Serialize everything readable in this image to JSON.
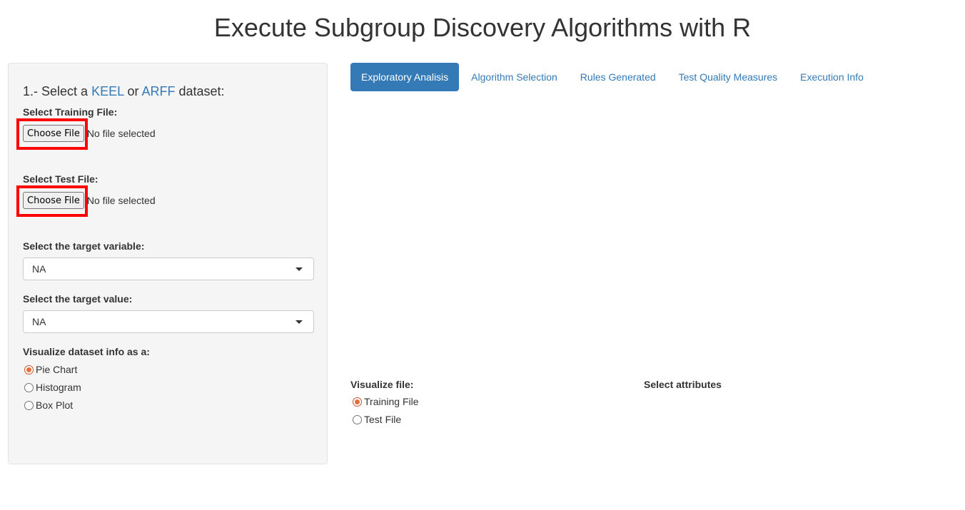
{
  "page": {
    "title": "Execute Subgroup Discovery Algorithms with R"
  },
  "sidebar": {
    "heading_prefix": "1.- Select a",
    "heading_link1": "KEEL",
    "heading_mid": "or",
    "heading_link2": "ARFF",
    "heading_suffix": "dataset:",
    "training_label": "Select Training File:",
    "training_button": "Choose File",
    "training_status": "No file selected",
    "test_label": "Select Test File:",
    "test_button": "Choose File",
    "test_status": "No file selected",
    "target_variable_label": "Select the target variable:",
    "target_variable_value": "NA",
    "target_value_label": "Select the target value:",
    "target_value_value": "NA",
    "visualize_label": "Visualize dataset info as a:",
    "viz_options": [
      {
        "label": "Pie Chart",
        "checked": true
      },
      {
        "label": "Histogram",
        "checked": false
      },
      {
        "label": "Box Plot",
        "checked": false
      }
    ]
  },
  "tabs": [
    {
      "label": "Exploratory Analisis",
      "active": true
    },
    {
      "label": "Algorithm Selection",
      "active": false
    },
    {
      "label": "Rules Generated",
      "active": false
    },
    {
      "label": "Test Quality Measures",
      "active": false
    },
    {
      "label": "Execution Info",
      "active": false
    }
  ],
  "main": {
    "visualize_file_label": "Visualize file:",
    "file_options": [
      {
        "label": "Training File",
        "checked": true
      },
      {
        "label": "Test File",
        "checked": false
      }
    ],
    "select_attributes_label": "Select attributes"
  },
  "colors": {
    "accent": "#337ab7",
    "highlight": "#ff0000",
    "radio_checked": "#e36f3f"
  }
}
